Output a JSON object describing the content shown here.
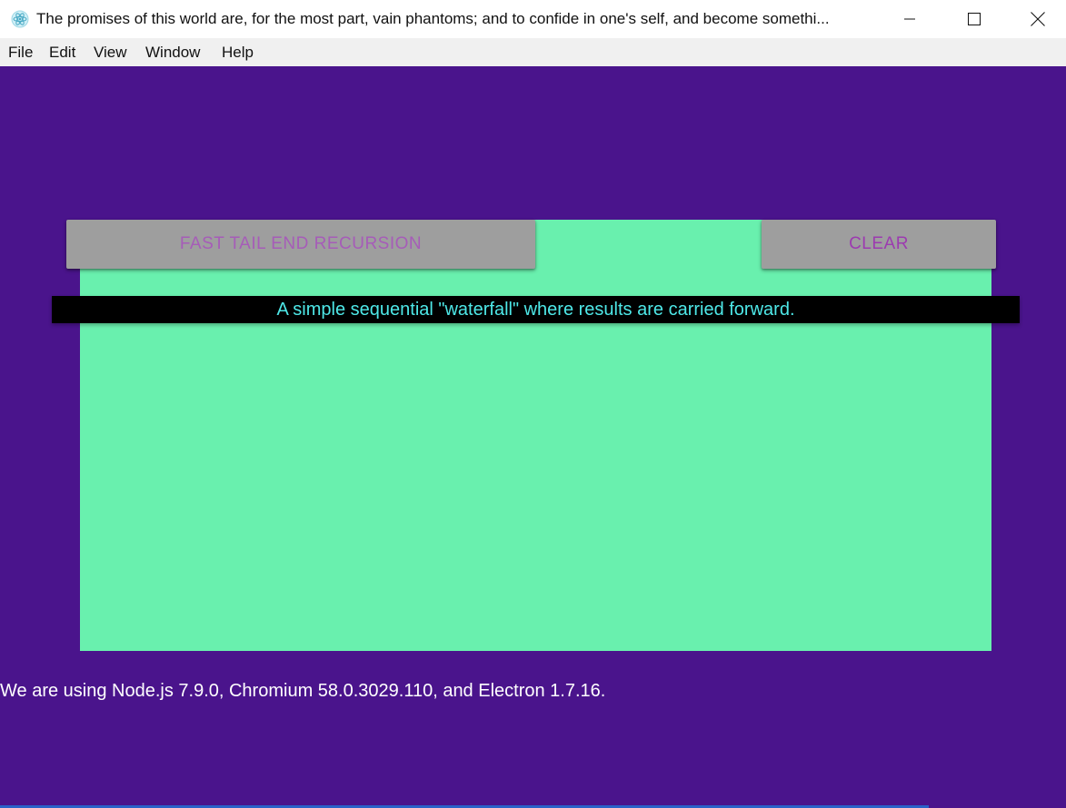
{
  "window": {
    "title": "The promises of this world are, for the most part, vain phantoms; and to confide in one's self, and become somethi...",
    "icon": "electron-atom-icon",
    "controls": {
      "minimize_icon": "minimize-icon",
      "maximize_icon": "maximize-icon",
      "close_icon": "close-icon"
    }
  },
  "menu": {
    "items": [
      "File",
      "Edit",
      "View",
      "Window",
      "Help"
    ]
  },
  "main": {
    "recursion_button": "FAST TAIL END RECURSION",
    "clear_button": "CLEAR",
    "description": "A simple sequential \"waterfall\" where results are carried forward."
  },
  "footer": {
    "versions": "We are using Node.js 7.9.0, Chromium 58.0.3029.110, and Electron 1.7.16."
  },
  "colors": {
    "background": "#4a148c",
    "panel": "#69f0ae",
    "button": "#9e9e9e",
    "button_text": "#9c3bb0",
    "banner": "#000000",
    "banner_text": "#4ee8e8",
    "footer_text": "#ffffff"
  }
}
